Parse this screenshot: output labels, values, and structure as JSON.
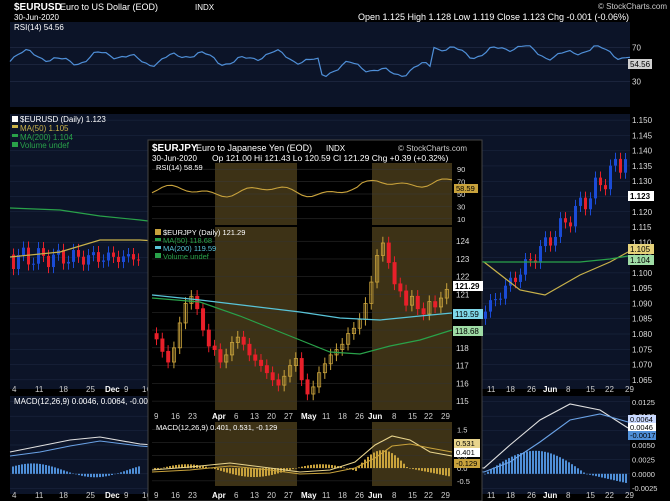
{
  "outer": {
    "header": {
      "symbol": "$EURUSD",
      "name": "Euro to US Dollar (EOD)",
      "exchange": "INDX",
      "date": "30-Jun-2020",
      "ohlc_text": "Open 1.125  High 1.128  Low 1.119  Close 1.123  Chg -0.001 (-0.06%)",
      "brand": "© StockCharts.com"
    },
    "rsi_label": "RSI(14) 54.56",
    "rsi_last": "54.56",
    "rsi_ticks": [
      "70",
      "50",
      "30"
    ],
    "legend": {
      "main": "$EURUSD (Daily) 1.123",
      "ma50": "MA(50) 1.105",
      "ma200": "MA(200) 1.104",
      "volume": "Volume undef"
    },
    "price_ticks": [
      "1.150",
      "1.145",
      "1.140",
      "1.135",
      "1.130",
      "1.125",
      "1.120",
      "1.115",
      "1.110",
      "1.105",
      "1.100",
      "1.095",
      "1.090",
      "1.085",
      "1.080",
      "1.075",
      "1.070",
      "1.065"
    ],
    "price_last": "1.123",
    "ma200_last": "1.104",
    "ma50_last": "1.105",
    "x_left": [
      "4",
      "11",
      "18",
      "25",
      "Dec",
      "9",
      "16",
      "23"
    ],
    "x_right": [
      "11",
      "18",
      "26",
      "Jun",
      "8",
      "15",
      "22",
      "29"
    ],
    "macd_label": "MACD(12,26,9) 0.0046, 0.0064, -0.00",
    "macd_ticks": [
      "0.0125",
      "0.0100",
      "0.0075",
      "0.0050",
      "0.0025",
      "0.0000",
      "-0.0025"
    ],
    "macd_last": [
      "0.0064",
      "0.0046",
      "-0.0017"
    ]
  },
  "inset": {
    "header": {
      "symbol": "$EURJPY",
      "name": "Euro to Japanese Yen (EOD)",
      "exchange": "INDX",
      "date": "30-Jun-2020",
      "ohlc_text": "Op 121.00  Hi 121.43  Lo 120.59  Cl 121.29  Chg +0.39 (+0.32%)",
      "brand": "© StockCharts.com"
    },
    "rsi_label": "RSI(14) 58.59",
    "rsi_last": "58.59",
    "rsi_ticks": [
      "90",
      "70",
      "50",
      "30",
      "10"
    ],
    "legend": {
      "main": "$EURJPY (Daily) 121.29",
      "ma50": "MA(50) 118.68",
      "ma200": "MA(200) 119.59",
      "volume": "Volume undef"
    },
    "price_ticks": [
      "124",
      "123",
      "122",
      "121",
      "120",
      "119",
      "118",
      "117",
      "116",
      "115"
    ],
    "price_last": "121.29",
    "ma200_last": "119.59",
    "ma50_last": "118.68",
    "x_labels": [
      "9",
      "16",
      "23",
      "Apr",
      "6",
      "13",
      "20",
      "27",
      "May",
      "11",
      "18",
      "26",
      "Jun",
      "8",
      "15",
      "22",
      "29"
    ],
    "macd_label": "MACD(12,26,9) 0.401, 0.531, -0.129",
    "macd_ticks": [
      "1.5",
      "1.0",
      "0.5",
      "0.0",
      "-0.5"
    ],
    "macd_last": [
      "0.531",
      "0.401",
      "-0.129"
    ]
  },
  "colors": {
    "up": "#1a4bd6",
    "down": "#e8202a",
    "rsi_line": "#4f8fd8",
    "ma50": "#c9b24a",
    "ma200": "#29a24a",
    "inset_bg": "#000000",
    "inset_band": "#3d3216",
    "inset_price": "#c8a23c",
    "inset_rsi": "#c8a23c"
  },
  "chart_data": [
    {
      "type": "candlestick",
      "title": "$EURUSD Euro to US Dollar (EOD)",
      "series": [
        {
          "name": "$EURUSD (Daily)",
          "last": 1.123,
          "open": 1.125,
          "high": 1.128,
          "low": 1.119,
          "close": 1.123
        },
        {
          "name": "MA(50)",
          "last": 1.105
        },
        {
          "name": "MA(200)",
          "last": 1.104
        }
      ],
      "ylim": [
        1.062,
        1.152
      ],
      "pattern_closes": [
        1.103,
        1.106,
        1.112,
        1.11,
        1.103,
        1.101,
        1.098,
        1.102,
        1.105,
        1.11,
        1.115,
        1.112,
        1.108,
        1.104,
        1.095,
        1.085,
        1.084,
        1.09,
        1.098,
        1.105,
        1.112,
        1.118,
        1.125,
        1.132,
        1.135,
        1.128,
        1.12,
        1.126,
        1.123
      ],
      "rsi": {
        "last": 54.56,
        "ylim": [
          0,
          100
        ]
      },
      "macd": {
        "macd": 0.0046,
        "signal": 0.0064,
        "hist": -0.0017
      }
    },
    {
      "type": "candlestick",
      "title": "$EURJPY Euro to Japanese Yen (EOD)",
      "series": [
        {
          "name": "$EURJPY (Daily)",
          "last": 121.29,
          "open": 121.0,
          "high": 121.43,
          "low": 120.59,
          "close": 121.29
        },
        {
          "name": "MA(50)",
          "last": 118.68
        },
        {
          "name": "MA(200)",
          "last": 119.59
        }
      ],
      "ylim": [
        114.5,
        125.0
      ],
      "closes": [
        118.5,
        117.8,
        117.2,
        118.0,
        119.4,
        120.5,
        120.9,
        120.2,
        119.0,
        118.1,
        117.9,
        117.2,
        117.6,
        118.3,
        118.6,
        118.2,
        117.6,
        117.3,
        117.0,
        116.6,
        116.2,
        115.9,
        116.4,
        117.0,
        117.4,
        116.2,
        115.4,
        115.8,
        116.6,
        117.1,
        117.6,
        117.9,
        118.2,
        118.8,
        119.1,
        119.6,
        120.5,
        121.7,
        123.2,
        123.9,
        122.8,
        121.6,
        121.2,
        120.4,
        120.9,
        120.2,
        119.9,
        120.6,
        120.3,
        120.8,
        121.29
      ],
      "rsi": {
        "last": 58.59,
        "ylim": [
          0,
          100
        ]
      },
      "macd": {
        "macd": 0.531,
        "signal": 0.401,
        "hist": -0.129
      }
    }
  ]
}
